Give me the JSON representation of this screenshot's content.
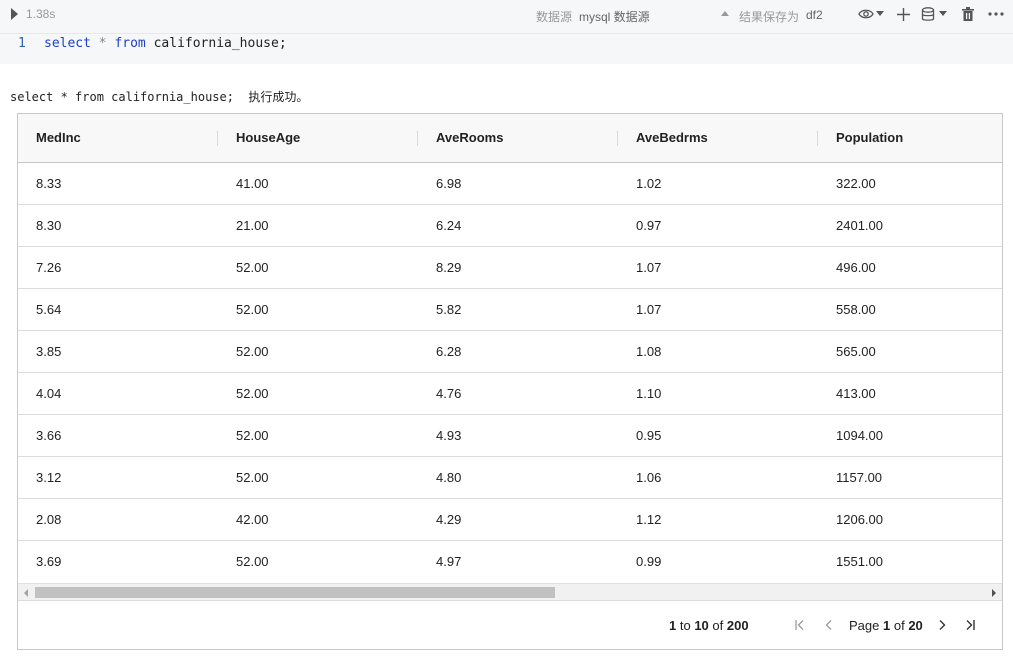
{
  "cell": {
    "exec_time": "1.38s",
    "datasource_label": "数据源",
    "datasource_value": "mysql 数据源",
    "save_label": "结果保存为",
    "save_value": "df2",
    "icons": [
      "eye-icon",
      "chevron-down-icon",
      "plus-icon",
      "database-icon",
      "chevron-down-icon",
      "trash-icon",
      "more-icon"
    ]
  },
  "editor": {
    "line_number": "1",
    "code": {
      "kw1": "select",
      "op": "*",
      "kw2": "from",
      "rest": "california_house;"
    }
  },
  "result": {
    "message": "select * from california_house;  执行成功。"
  },
  "grid": {
    "columns": [
      "MedInc",
      "HouseAge",
      "AveRooms",
      "AveBedrms",
      "Population"
    ],
    "rows": [
      [
        "8.33",
        "41.00",
        "6.98",
        "1.02",
        "322.00"
      ],
      [
        "8.30",
        "21.00",
        "6.24",
        "0.97",
        "2401.00"
      ],
      [
        "7.26",
        "52.00",
        "8.29",
        "1.07",
        "496.00"
      ],
      [
        "5.64",
        "52.00",
        "5.82",
        "1.07",
        "558.00"
      ],
      [
        "3.85",
        "52.00",
        "6.28",
        "1.08",
        "565.00"
      ],
      [
        "4.04",
        "52.00",
        "4.76",
        "1.10",
        "413.00"
      ],
      [
        "3.66",
        "52.00",
        "4.93",
        "0.95",
        "1094.00"
      ],
      [
        "3.12",
        "52.00",
        "4.80",
        "1.06",
        "1157.00"
      ],
      [
        "2.08",
        "42.00",
        "4.29",
        "1.12",
        "1206.00"
      ],
      [
        "3.69",
        "52.00",
        "4.97",
        "0.99",
        "1551.00"
      ]
    ]
  },
  "pager": {
    "from": "1",
    "to_word": "to",
    "to": "10",
    "of_word": "of",
    "total": "200",
    "page_word": "Page",
    "page": "1",
    "page_of_word": "of",
    "pages": "20"
  }
}
